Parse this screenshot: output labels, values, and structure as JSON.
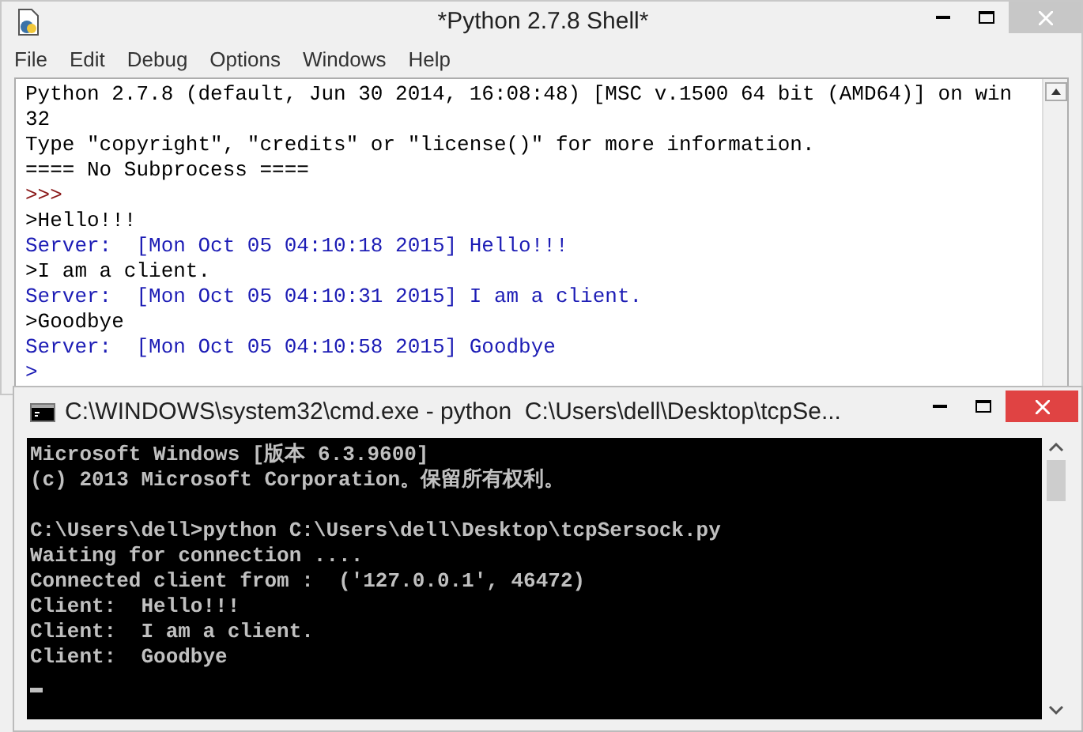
{
  "shell_window": {
    "title": "*Python 2.7.8 Shell*",
    "menu": [
      "File",
      "Edit",
      "Debug",
      "Options",
      "Windows",
      "Help"
    ],
    "lines": [
      {
        "kind": "output",
        "text": "Python 2.7.8 (default, Jun 30 2014, 16:08:48) [MSC v.1500 64 bit (AMD64)] on win"
      },
      {
        "kind": "output",
        "text": "32"
      },
      {
        "kind": "output",
        "text": "Type \"copyright\", \"credits\" or \"license()\" for more information."
      },
      {
        "kind": "output",
        "text": "==== No Subprocess ===="
      },
      {
        "kind": "prompt",
        "text": ">>>"
      },
      {
        "kind": "input",
        "text": ">Hello!!!"
      },
      {
        "kind": "server",
        "text": "Server:  [Mon Oct 05 04:10:18 2015] Hello!!!"
      },
      {
        "kind": "input",
        "text": ">I am a client."
      },
      {
        "kind": "server",
        "text": "Server:  [Mon Oct 05 04:10:31 2015] I am a client."
      },
      {
        "kind": "input",
        "text": ">Goodbye"
      },
      {
        "kind": "server",
        "text": "Server:  [Mon Oct 05 04:10:58 2015] Goodbye"
      },
      {
        "kind": "server",
        "text": ">"
      }
    ]
  },
  "console_window": {
    "title": "C:\\WINDOWS\\system32\\cmd.exe - python  C:\\Users\\dell\\Desktop\\tcpSe...",
    "blocks": [
      {
        "lines": [
          "Microsoft Windows [版本 6.3.9600]",
          "(c) 2013 Microsoft Corporation。保留所有权利。"
        ]
      },
      {
        "lines": [
          "C:\\Users\\dell>python C:\\Users\\dell\\Desktop\\tcpSersock.py",
          "Waiting for connection ....",
          "Connected client from :  ('127.0.0.1', 46472)",
          "Client:  Hello!!!",
          "Client:  I am a client.",
          "Client:  Goodbye"
        ]
      }
    ]
  }
}
